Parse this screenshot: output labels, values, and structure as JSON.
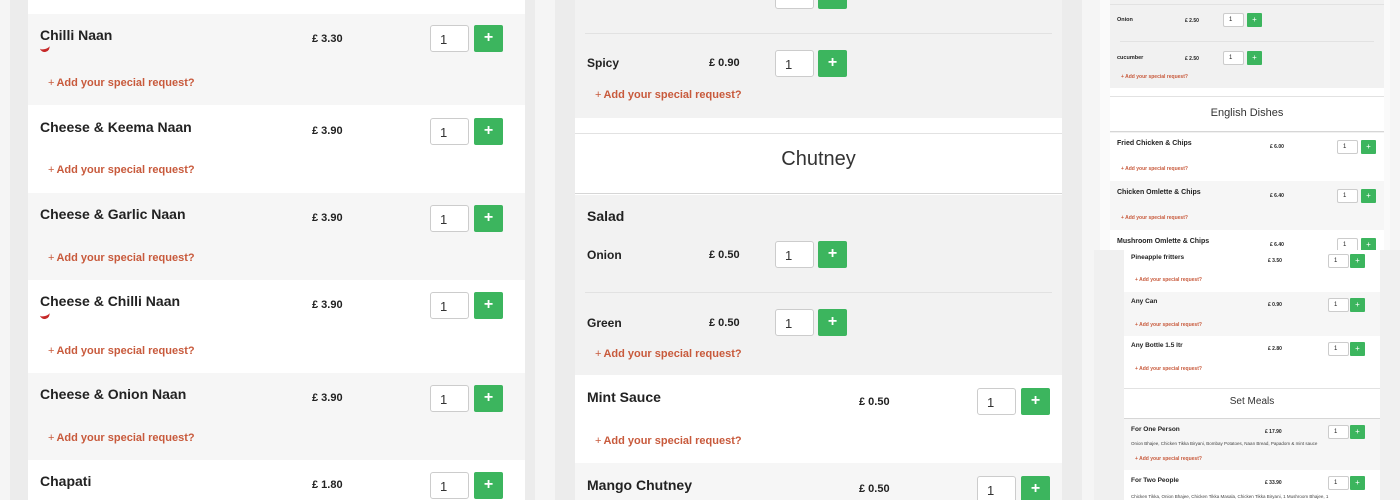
{
  "currency": "£",
  "accent_color": "#3cb55e",
  "request_color": "#c85a3c",
  "request_label": "Add your special request?",
  "add_icon": "plus-icon",
  "column1": {
    "items": [
      {
        "name": "Chilli Naan",
        "price": "£ 3.30",
        "qty": "1",
        "spicy": true
      },
      {
        "name": "Cheese & Keema Naan",
        "price": "£ 3.90",
        "qty": "1",
        "spicy": false
      },
      {
        "name": "Cheese & Garlic Naan",
        "price": "£ 3.90",
        "qty": "1",
        "spicy": false
      },
      {
        "name": "Cheese & Chilli Naan",
        "price": "£ 3.90",
        "qty": "1",
        "spicy": true
      },
      {
        "name": "Cheese & Onion Naan",
        "price": "£ 3.90",
        "qty": "1",
        "spicy": false
      },
      {
        "name": "Chapati",
        "price": "£ 1.80",
        "qty": "1",
        "spicy": false
      }
    ]
  },
  "column2": {
    "top_option": {
      "name": "Spicy",
      "price": "£ 0.90",
      "qty": "1"
    },
    "section_title": "Chutney",
    "salad": {
      "name": "Salad",
      "options": [
        {
          "name": "Onion",
          "price": "£ 0.50",
          "qty": "1"
        },
        {
          "name": "Green",
          "price": "£ 0.50",
          "qty": "1"
        }
      ]
    },
    "items": [
      {
        "name": "Mint Sauce",
        "price": "£ 0.50",
        "qty": "1"
      },
      {
        "name": "Mango Chutney",
        "price": "£ 0.50",
        "qty": "1"
      }
    ]
  },
  "column3": {
    "top_options": [
      {
        "name": "Onion",
        "price": "£ 2.50",
        "qty": "1"
      },
      {
        "name": "cucumber",
        "price": "£ 2.50",
        "qty": "1"
      }
    ],
    "section_title": "English Dishes",
    "items": [
      {
        "name": "Fried Chicken & Chips",
        "price": "£ 6.00",
        "qty": "1"
      },
      {
        "name": "Chicken Omlette & Chips",
        "price": "£ 6.40",
        "qty": "1"
      },
      {
        "name": "Mushroom Omlette & Chips",
        "price": "£ 6.40",
        "qty": "1"
      }
    ]
  },
  "column4": {
    "items": [
      {
        "name": "Pineapple fritters",
        "price": "£ 3.50",
        "qty": "1"
      },
      {
        "name": "Any Can",
        "price": "£ 0.90",
        "qty": "1"
      },
      {
        "name": "Any Bottle 1.5 ltr",
        "price": "£ 2.80",
        "qty": "1"
      }
    ],
    "section_title": "Set Meals",
    "set_meals": [
      {
        "name": "For One Person",
        "price": "£ 17.90",
        "qty": "1",
        "description": "Onion Bhajee, Chicken Tikka Biryani, Bombay Potatoes, Naan Bread, Papadom & mint sauce"
      },
      {
        "name": "For Two People",
        "price": "£ 33.90",
        "qty": "1",
        "description": "Chicken Tikka, Onion Bhajee, Chicken Tikka Masala, Chicken Tikka Biryani, 1 Mushroom Bhajee, 1"
      }
    ]
  }
}
